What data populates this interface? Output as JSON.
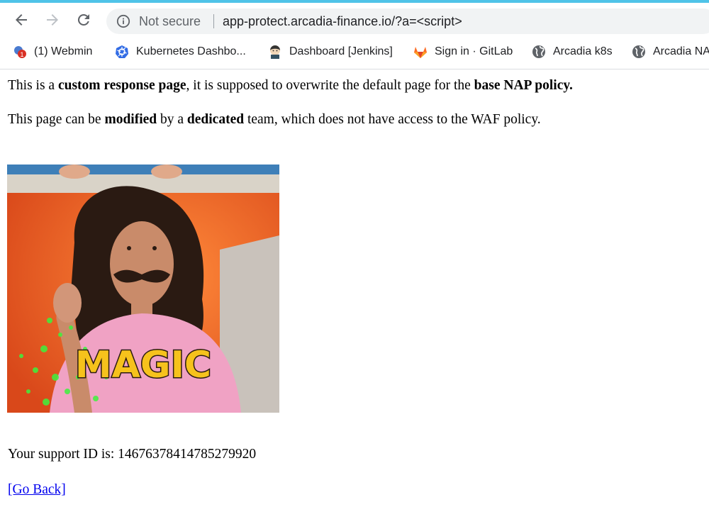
{
  "browser": {
    "security_label": "Not secure",
    "url": "app-protect.arcadia-finance.io/?a=<script>",
    "accent_color": "#4fc3e8"
  },
  "bookmarks": [
    {
      "label": "(1) Webmin",
      "icon": "webmin-icon"
    },
    {
      "label": "Kubernetes Dashbo...",
      "icon": "kubernetes-icon"
    },
    {
      "label": "Dashboard [Jenkins]",
      "icon": "jenkins-icon"
    },
    {
      "label": "Sign in · GitLab",
      "icon": "gitlab-icon"
    },
    {
      "label": "Arcadia k8s",
      "icon": "globe-icon"
    },
    {
      "label": "Arcadia NAP",
      "icon": "globe-icon"
    }
  ],
  "page": {
    "p1": {
      "a": "This is a ",
      "b": "custom response page",
      "c": ", it is supposed to overwrite the default page for the ",
      "d": "base NAP policy."
    },
    "p2": {
      "a": "This page can be ",
      "b": "modified",
      "c": " by a ",
      "d": "dedicated",
      "e": " team, which does not have access to the WAF policy."
    },
    "gif_caption": "MAGIC",
    "support_prefix": "Your support ID is: ",
    "support_id": "14676378414785279920",
    "go_back": "[Go Back]"
  }
}
